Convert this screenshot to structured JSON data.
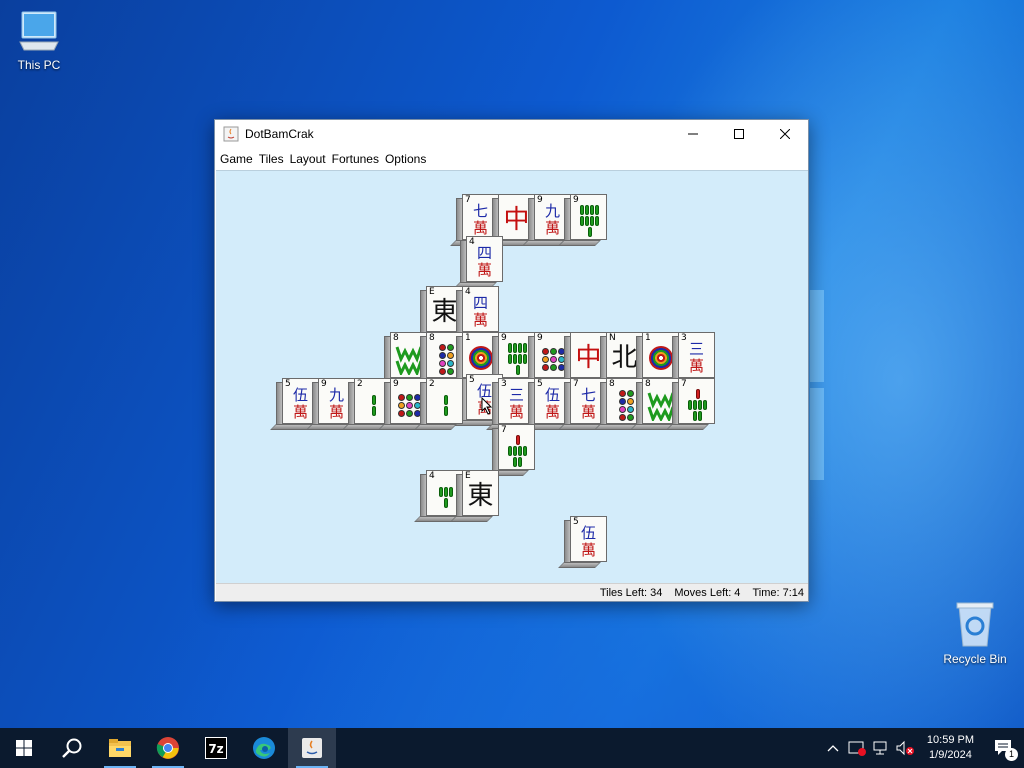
{
  "desktop": {
    "icons": [
      {
        "label": "This PC"
      },
      {
        "label": "Recycle Bin"
      }
    ]
  },
  "window": {
    "title": "DotBamCrak",
    "menus": [
      "Game",
      "Tiles",
      "Layout",
      "Fortunes",
      "Options"
    ],
    "status": {
      "tiles_left": "Tiles Left: 34",
      "moves_left": "Moves Left: 4",
      "time": "Time: 7:14"
    }
  },
  "tiles": [
    {
      "num": "7",
      "kind": "crak",
      "top": "七",
      "bottom": "萬"
    },
    {
      "num": "",
      "kind": "dragon-red",
      "char": "中"
    },
    {
      "num": "9",
      "kind": "crak",
      "top": "九",
      "bottom": "萬"
    },
    {
      "num": "9",
      "kind": "bam",
      "count": 9
    },
    {
      "num": "4",
      "kind": "crak",
      "top": "四",
      "bottom": "萬"
    },
    {
      "num": "E",
      "kind": "wind",
      "char": "東"
    },
    {
      "num": "4",
      "kind": "crak",
      "top": "四",
      "bottom": "萬"
    },
    {
      "num": "8",
      "kind": "green"
    },
    {
      "num": "8",
      "kind": "dots",
      "count": 8
    },
    {
      "num": "1",
      "kind": "onedot"
    },
    {
      "num": "9",
      "kind": "bam",
      "count": 9
    },
    {
      "num": "9",
      "kind": "dots",
      "count": 9
    },
    {
      "num": "",
      "kind": "dragon-red",
      "char": "中"
    },
    {
      "num": "N",
      "kind": "wind",
      "char": "北"
    },
    {
      "num": "1",
      "kind": "onedot"
    },
    {
      "num": "3",
      "kind": "crak",
      "top": "三",
      "bottom": "萬"
    },
    {
      "num": "5",
      "kind": "crak",
      "top": "伍",
      "bottom": "萬"
    },
    {
      "num": "9",
      "kind": "crak",
      "top": "九",
      "bottom": "萬"
    },
    {
      "num": "2",
      "kind": "bam",
      "count": 2
    },
    {
      "num": "9",
      "kind": "dots",
      "count": 9
    },
    {
      "num": "2",
      "kind": "bam",
      "count": 2
    },
    {
      "num": "5",
      "kind": "crak",
      "top": "伍",
      "bottom": "萬"
    },
    {
      "num": "3",
      "kind": "crak",
      "top": "三",
      "bottom": "萬"
    },
    {
      "num": "5",
      "kind": "crak",
      "top": "伍",
      "bottom": "萬"
    },
    {
      "num": "7",
      "kind": "crak",
      "top": "七",
      "bottom": "萬"
    },
    {
      "num": "8",
      "kind": "dots",
      "count": 8
    },
    {
      "num": "8",
      "kind": "green"
    },
    {
      "num": "7",
      "kind": "bam",
      "count": 7
    },
    {
      "num": "7",
      "kind": "bam",
      "count": 7
    },
    {
      "num": "4",
      "kind": "bam",
      "count": 4
    },
    {
      "num": "E",
      "kind": "wind",
      "char": "東"
    },
    {
      "num": "5",
      "kind": "crak",
      "top": "伍",
      "bottom": "萬"
    }
  ],
  "taskbar": {
    "apps": [
      "start-icon",
      "search-icon",
      "file-explorer-icon",
      "chrome-icon",
      "7zip-icon",
      "edge-icon",
      "java-icon"
    ],
    "clock_time": "10:59 PM",
    "clock_date": "1/9/2024",
    "notification_count": "1"
  },
  "colors": {
    "board": "#d3ecfa",
    "taskbar": "#0b1a2e",
    "crak_top": "#1d2aa8",
    "crak_wan": "#c01818",
    "bam": "#1e9a1e"
  }
}
